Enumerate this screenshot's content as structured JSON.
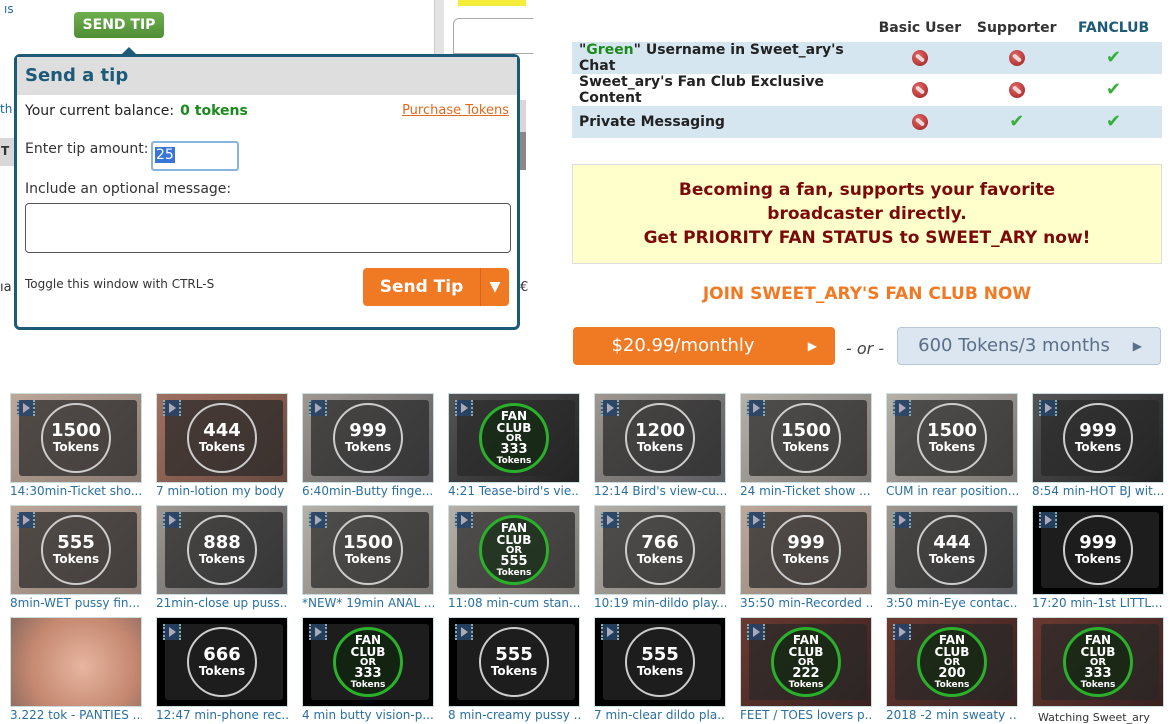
{
  "background": {
    "fragment_top_left": "ıs",
    "fragment_left_1": "th",
    "fragment_left_2": "T",
    "fragment_left_3": "ıa",
    "fragment_right_1": "€"
  },
  "send_tip_top_button": "SEND TIP",
  "tip_popup": {
    "title": "Send a tip",
    "balance_label": "Your current balance:",
    "balance_value": "0 tokens",
    "purchase_link": "Purchase Tokens",
    "amount_label": "Enter tip amount:",
    "amount_value": "25",
    "message_label": "Include an optional message:",
    "message_value": "",
    "toggle_hint": "Toggle this window with CTRL-S",
    "send_button": "Send Tip",
    "dropdown_icon": "▼"
  },
  "perks": {
    "columns": [
      "Basic User",
      "Supporter",
      "FANCLUB"
    ],
    "rows": [
      {
        "pre": "\"",
        "green": "Green",
        "post": "\" Username in Sweet_ary's Chat",
        "values": [
          "no",
          "no",
          "yes"
        ]
      },
      {
        "pre": "Sweet_ary's Fan Club Exclusive Content",
        "green": "",
        "post": "",
        "values": [
          "no",
          "no",
          "yes"
        ]
      },
      {
        "pre": "Private Messaging",
        "green": "",
        "post": "",
        "values": [
          "no",
          "yes",
          "yes"
        ]
      }
    ]
  },
  "promo": {
    "line1": "Becoming a fan, supports your favorite broadcaster directly.",
    "line2": "Get PRIORITY FAN STATUS to SWEET_ARY now!"
  },
  "join": {
    "title": "JOIN SWEET_ARY'S FAN CLUB NOW",
    "monthly_button": "$20.99/monthly",
    "or_text": "- or -",
    "tokens_button": "600 Tokens/3 months",
    "arrow": "▶"
  },
  "videos": [
    {
      "title": "14:30min-Ticket sho...",
      "price": "1500",
      "fan": false,
      "bg": "bg-a"
    },
    {
      "title": "7 min-lotion my body",
      "price": "444",
      "fan": false,
      "bg": "bg-b"
    },
    {
      "title": "6:40min-Butty finge...",
      "price": "999",
      "fan": false,
      "bg": "bg-c"
    },
    {
      "title": "4:21 Tease-bird's vie...",
      "price": "333",
      "fan": true,
      "bg": "bg-d"
    },
    {
      "title": "12:14 Bird's view-cu...",
      "price": "1200",
      "fan": false,
      "bg": "bg-c"
    },
    {
      "title": "24 min-Ticket show ...",
      "price": "1500",
      "fan": false,
      "bg": "bg-e"
    },
    {
      "title": "CUM in rear position...",
      "price": "1500",
      "fan": false,
      "bg": "bg-e"
    },
    {
      "title": "8:54 min-HOT BJ wit...",
      "price": "999",
      "fan": false,
      "bg": "bg-d"
    },
    {
      "title": "8min-WET pussy fin...",
      "price": "555",
      "fan": false,
      "bg": "bg-a"
    },
    {
      "title": "21min-close up puss...",
      "price": "888",
      "fan": false,
      "bg": "bg-c"
    },
    {
      "title": "*NEW* 19min ANAL ...",
      "price": "1500",
      "fan": false,
      "bg": "bg-e"
    },
    {
      "title": "11:08 min-cum stan...",
      "price": "555",
      "fan": true,
      "bg": "bg-e"
    },
    {
      "title": "10:19 min-dildo play...",
      "price": "766",
      "fan": false,
      "bg": "bg-e"
    },
    {
      "title": "35:50 min-Recorded ...",
      "price": "999",
      "fan": false,
      "bg": "bg-a"
    },
    {
      "title": "3:50 min-Eye contac...",
      "price": "444",
      "fan": false,
      "bg": "bg-c"
    },
    {
      "title": "17:20 min-1st LITTL...",
      "price": "999",
      "fan": false,
      "bg": "bg-black"
    },
    {
      "title": "3.222 tok - PANTIES ...",
      "price": "",
      "fan": false,
      "bg": "bg-skin",
      "image_only": true
    },
    {
      "title": "12:47 min-phone rec...",
      "price": "666",
      "fan": false,
      "bg": "bg-black"
    },
    {
      "title": "4 min butty vision-p...",
      "price": "333",
      "fan": true,
      "bg": "bg-black"
    },
    {
      "title": "8 min-creamy pussy ...",
      "price": "555",
      "fan": false,
      "bg": "bg-black"
    },
    {
      "title": "7 min-clear dildo pla...",
      "price": "555",
      "fan": false,
      "bg": "bg-black"
    },
    {
      "title": "FEET / TOES lovers p...",
      "price": "222",
      "fan": true,
      "bg": "bg-red"
    },
    {
      "title": "2018 -2 min sweaty ...",
      "price": "200",
      "fan": true,
      "bg": "bg-red"
    },
    {
      "title": "Watching Sweet_ary",
      "price": "333",
      "fan": true,
      "bg": "bg-red",
      "tooltip": true
    }
  ],
  "badge_text": {
    "tokens": "Tokens",
    "fan_line1": "FAN",
    "fan_line2": "CLUB",
    "fan_or": "OR"
  }
}
